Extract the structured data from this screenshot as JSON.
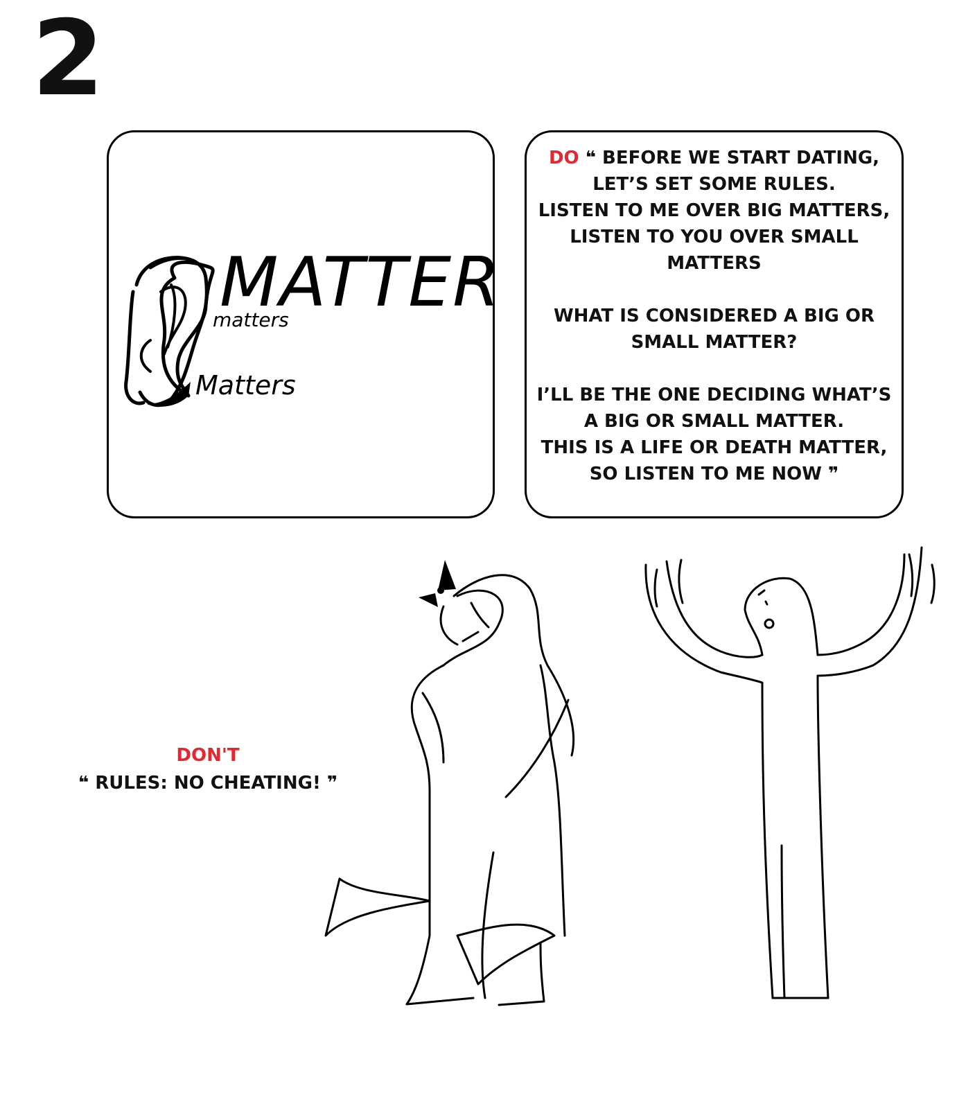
{
  "page": {
    "number": "2"
  },
  "panel_left": {
    "word_large": "MATTERS",
    "word_small": "matters",
    "word_medium": "Matters"
  },
  "panel_right": {
    "do_label": "DO",
    "open_quote": "❝",
    "close_quote": "❞",
    "lines": {
      "l1": "BEFORE WE START DATING,",
      "l2": "LET’S SET SOME RULES.",
      "l3": "LISTEN TO ME OVER BIG MATTERS,",
      "l4": "LISTEN TO YOU OVER SMALL",
      "l5": "MATTERS",
      "l6": "WHAT IS CONSIDERED A BIG OR",
      "l7": "SMALL MATTER?",
      "l8": "I’LL BE THE ONE DECIDING WHAT’S",
      "l9": "A BIG OR SMALL MATTER.",
      "l10": "THIS IS A LIFE OR DEATH MATTER,",
      "l11": "SO LISTEN TO ME NOW"
    }
  },
  "dont_block": {
    "label": "DON'T",
    "open_quote": "❝",
    "text": "RULES: NO CHEATING!",
    "close_quote": "❞"
  },
  "colors": {
    "accent_red": "#e8262f",
    "ink": "#000000",
    "background": "#ffffff"
  }
}
